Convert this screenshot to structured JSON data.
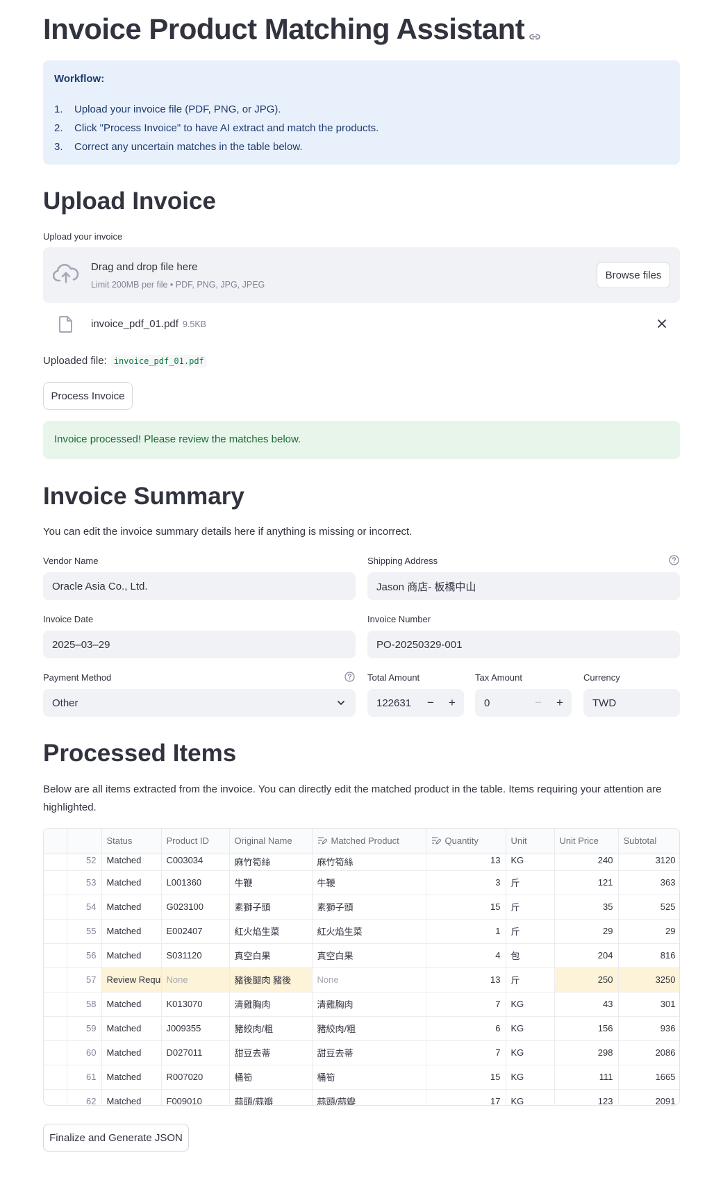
{
  "title": "Invoice Product Matching Assistant",
  "workflow": {
    "heading": "Workflow:",
    "steps": [
      {
        "n": "1.",
        "text": "Upload your invoice file (PDF, PNG, or JPG)."
      },
      {
        "n": "2.",
        "text": "Click \"Process Invoice\" to have AI extract and match the products."
      },
      {
        "n": "3.",
        "text": "Correct any uncertain matches in the table below."
      }
    ]
  },
  "upload": {
    "heading": "Upload Invoice",
    "label": "Upload your invoice",
    "dropzone_title": "Drag and drop file here",
    "dropzone_sub": "Limit 200MB per file • PDF, PNG, JPG, JPEG",
    "browse_label": "Browse files",
    "file_name": "invoice_pdf_01.pdf",
    "file_size": "9.5KB",
    "uploaded_label": "Uploaded file:",
    "uploaded_value": "invoice_pdf_01.pdf",
    "process_label": "Process Invoice",
    "success_msg": "Invoice processed! Please review the matches below."
  },
  "summary": {
    "heading": "Invoice Summary",
    "desc": "You can edit the invoice summary details here if anything is missing or incorrect.",
    "vendor_label": "Vendor Name",
    "vendor_value": "Oracle Asia Co., Ltd.",
    "shipping_label": "Shipping Address",
    "shipping_value": "Jason 商店- 板橋中山",
    "date_label": "Invoice Date",
    "date_value": "2025–03–29",
    "number_label": "Invoice Number",
    "number_value": "PO-20250329-001",
    "payment_label": "Payment Method",
    "payment_value": "Other",
    "total_label": "Total Amount",
    "total_value": "122631",
    "tax_label": "Tax Amount",
    "tax_value": "0",
    "currency_label": "Currency",
    "currency_value": "TWD"
  },
  "items": {
    "heading": "Processed Items",
    "desc_line1": "Below are all items extracted from the invoice. You can directly edit the matched product in the table. Items requiring your attention are",
    "desc_line2": "highlighted.",
    "columns": {
      "status": "Status",
      "product_id": "Product ID",
      "original": "Original Name",
      "matched": "Matched Product",
      "quantity": "Quantity",
      "unit": "Unit",
      "unit_price": "Unit Price",
      "subtotal": "Subtotal"
    },
    "rows": [
      {
        "idx": "52",
        "status": "Matched",
        "pid": "C003034",
        "orig": "麻竹筍絲",
        "matched": "麻竹筍絲",
        "qty": "13",
        "unit": "KG",
        "price": "240",
        "sub": "3120"
      },
      {
        "idx": "53",
        "status": "Matched",
        "pid": "L001360",
        "orig": "牛鞭",
        "matched": "牛鞭",
        "qty": "3",
        "unit": "斤",
        "price": "121",
        "sub": "363"
      },
      {
        "idx": "54",
        "status": "Matched",
        "pid": "G023100",
        "orig": "素獅子頭",
        "matched": "素獅子頭",
        "qty": "15",
        "unit": "斤",
        "price": "35",
        "sub": "525"
      },
      {
        "idx": "55",
        "status": "Matched",
        "pid": "E002407",
        "orig": "紅火焰生菜",
        "matched": "紅火焰生菜",
        "qty": "1",
        "unit": "斤",
        "price": "29",
        "sub": "29"
      },
      {
        "idx": "56",
        "status": "Matched",
        "pid": "S031120",
        "orig": "真空白果",
        "matched": "真空白果",
        "qty": "4",
        "unit": "包",
        "price": "204",
        "sub": "816"
      },
      {
        "idx": "57",
        "status": "Review Requi",
        "pid": "None",
        "orig": "豬後腿肉 豬後",
        "matched": "None",
        "qty": "13",
        "unit": "斤",
        "price": "250",
        "sub": "3250"
      },
      {
        "idx": "58",
        "status": "Matched",
        "pid": "K013070",
        "orig": "清雞胸肉",
        "matched": "清雞胸肉",
        "qty": "7",
        "unit": "KG",
        "price": "43",
        "sub": "301"
      },
      {
        "idx": "59",
        "status": "Matched",
        "pid": "J009355",
        "orig": "豬絞肉/粗",
        "matched": "豬絞肉/粗",
        "qty": "6",
        "unit": "KG",
        "price": "156",
        "sub": "936"
      },
      {
        "idx": "60",
        "status": "Matched",
        "pid": "D027011",
        "orig": "甜豆去蒂",
        "matched": "甜豆去蒂",
        "qty": "7",
        "unit": "KG",
        "price": "298",
        "sub": "2086"
      },
      {
        "idx": "61",
        "status": "Matched",
        "pid": "R007020",
        "orig": "桶筍",
        "matched": "桶筍",
        "qty": "15",
        "unit": "KG",
        "price": "111",
        "sub": "1665"
      },
      {
        "idx": "62",
        "status": "Matched",
        "pid": "F009010",
        "orig": "蒜頭/蒜瓣",
        "matched": "蒜頭/蒜瓣",
        "qty": "17",
        "unit": "KG",
        "price": "123",
        "sub": "2091"
      }
    ]
  },
  "finalize_label": "Finalize and Generate JSON"
}
